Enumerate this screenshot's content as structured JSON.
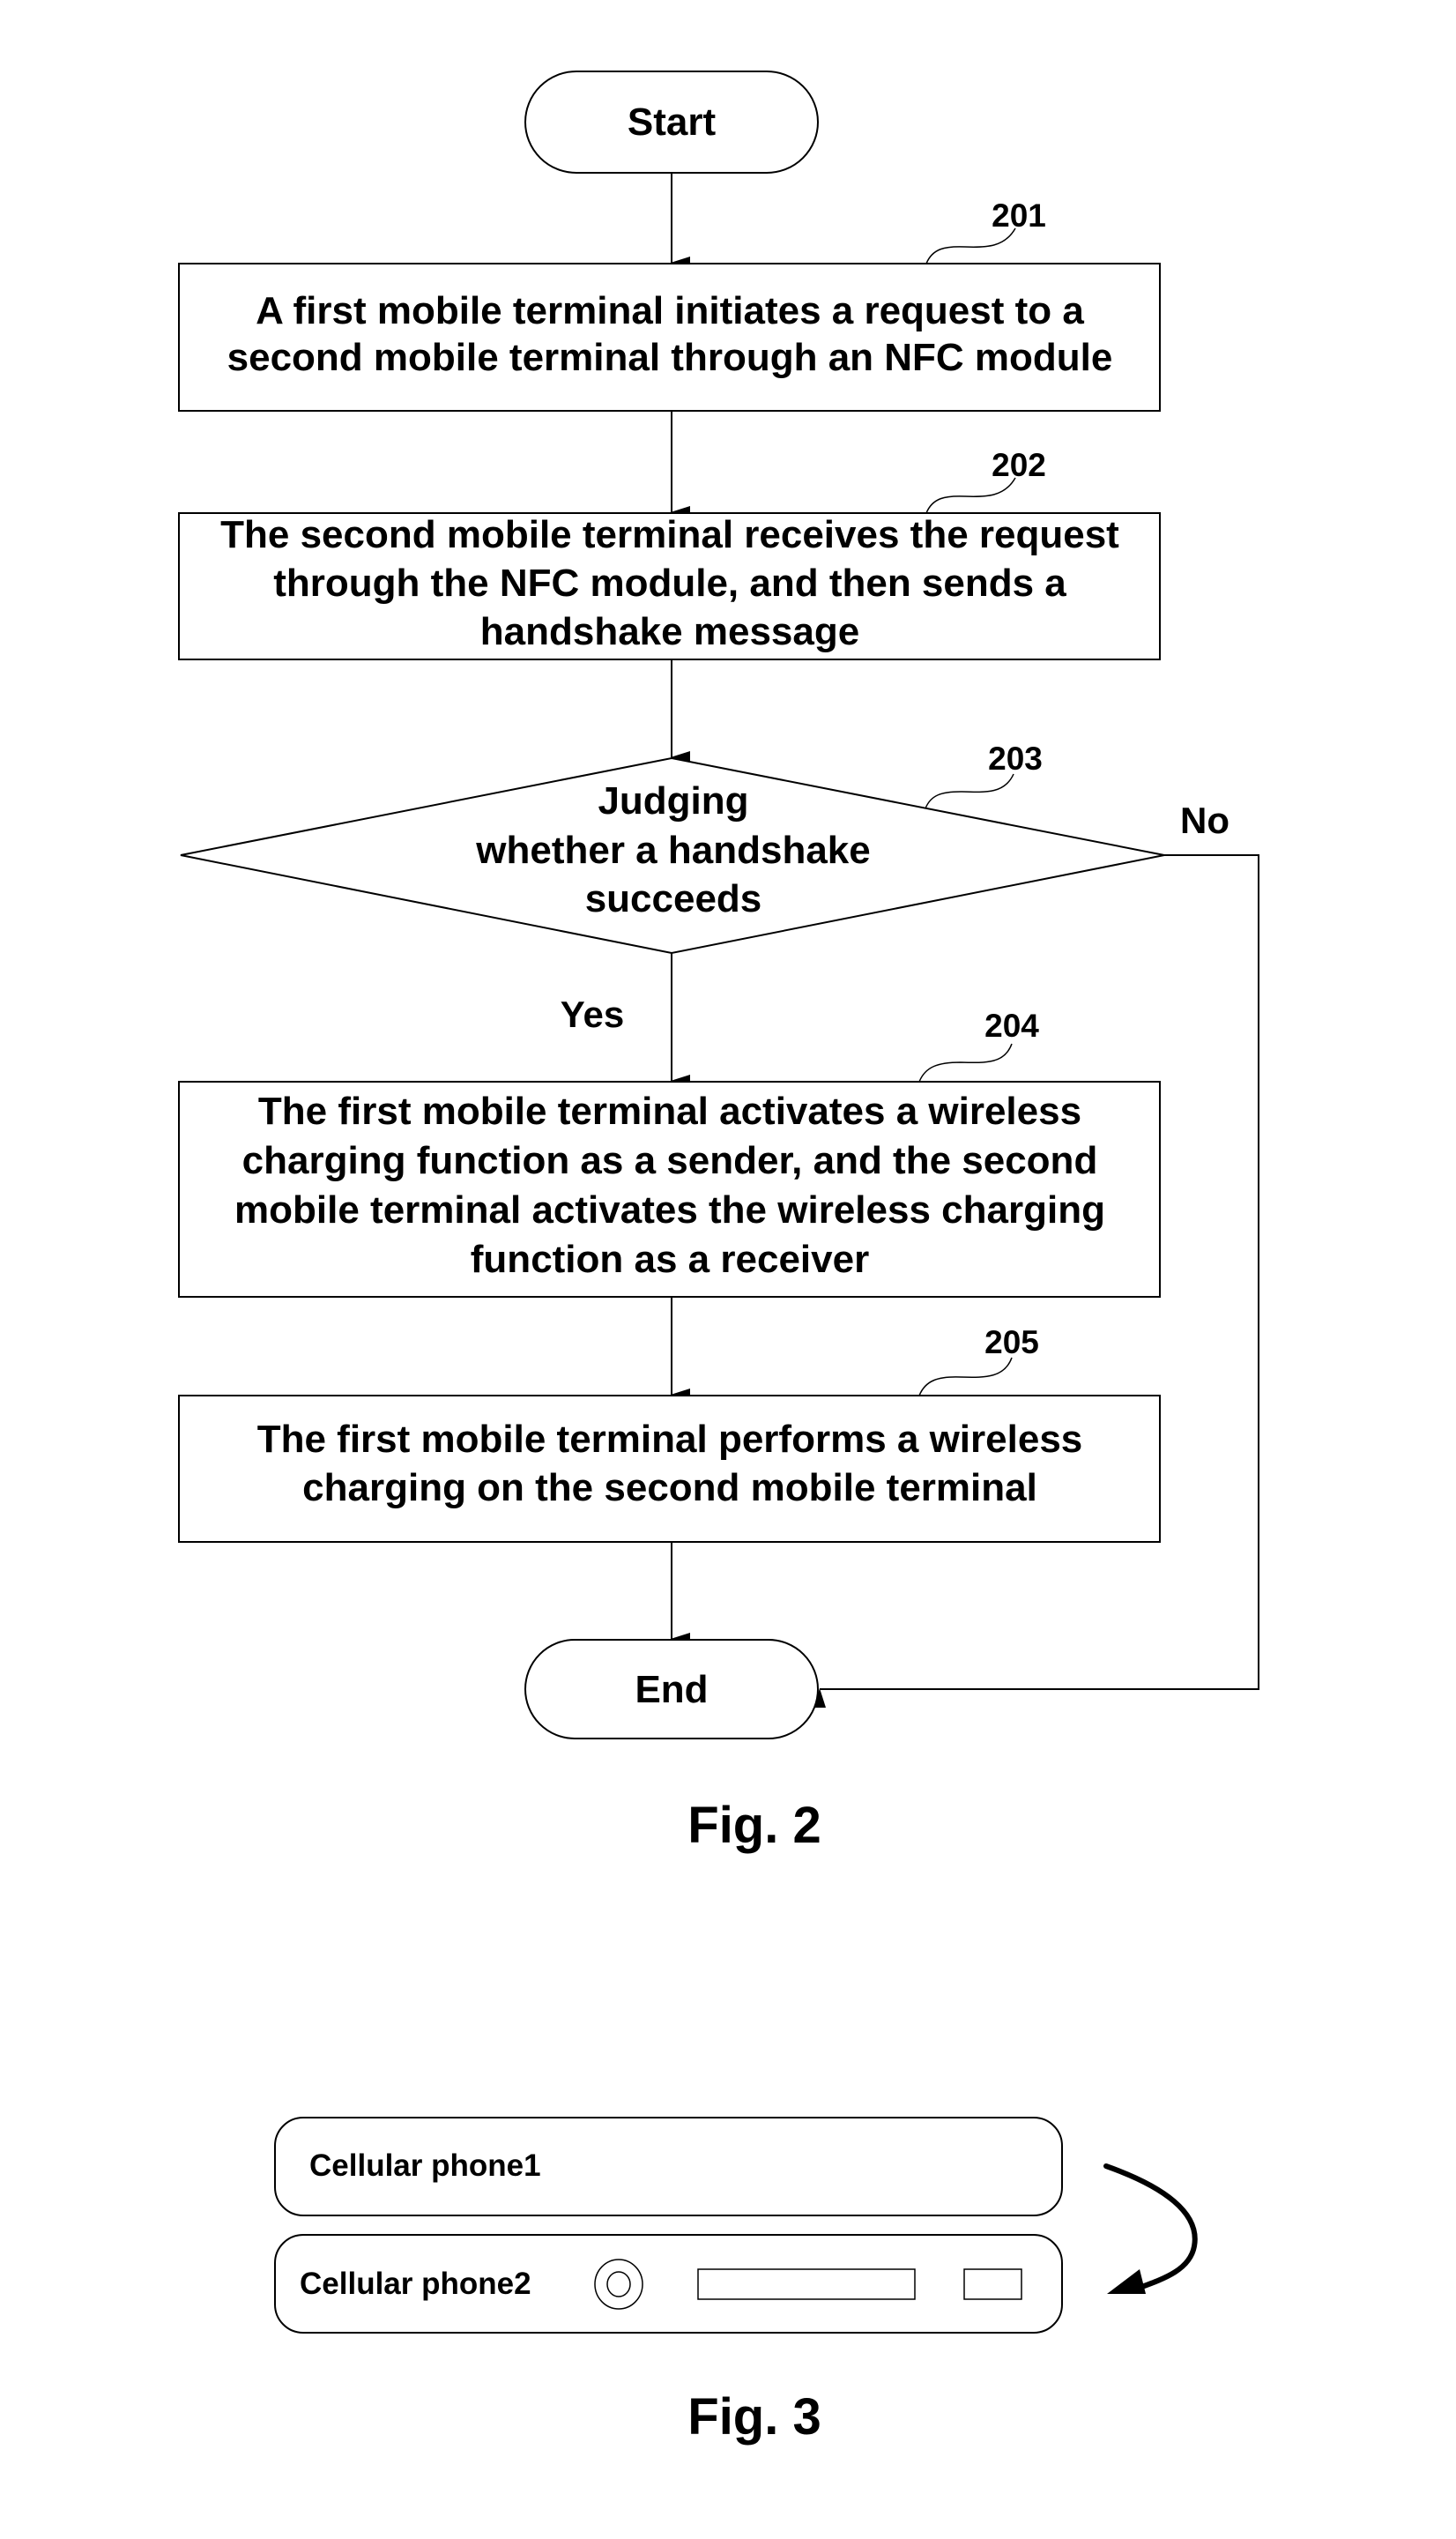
{
  "fig2": {
    "caption": "Fig. 2",
    "start": "Start",
    "end": "End",
    "steps": [
      {
        "ref": "201",
        "lines": [
          "A first mobile terminal initiates a request to a",
          "second mobile terminal through an NFC module"
        ]
      },
      {
        "ref": "202",
        "lines": [
          "The second mobile terminal receives the request",
          "through the NFC module, and then sends a",
          "handshake message"
        ]
      },
      {
        "ref": "203",
        "lines": [
          "Judging",
          "whether a handshake",
          "succeeds"
        ],
        "yes_label": "Yes",
        "no_label": "No"
      },
      {
        "ref": "204",
        "lines": [
          "The first mobile terminal activates a wireless",
          "charging function as a sender, and the second",
          "mobile terminal activates the wireless charging",
          "function as a receiver"
        ]
      },
      {
        "ref": "205",
        "lines": [
          "The first mobile terminal performs a wireless",
          "charging on the second mobile terminal"
        ]
      }
    ]
  },
  "fig3": {
    "caption": "Fig. 3",
    "phone1_label": "Cellular phone1",
    "phone2_label": "Cellular phone2"
  }
}
